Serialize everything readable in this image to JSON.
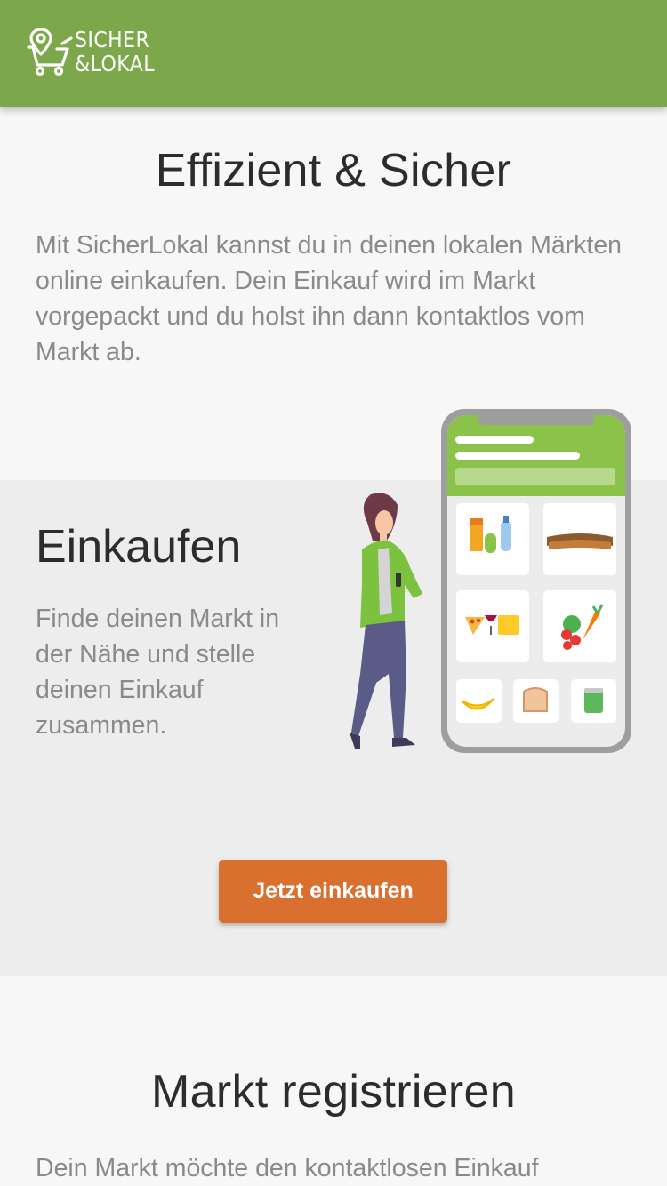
{
  "header": {
    "logo_line1": "SICHER",
    "logo_line2": "&LOKAL",
    "brand_color": "#7ca74a"
  },
  "intro": {
    "title": "Effizient & Sicher",
    "text": "Mit SicherLokal kannst du in deinen lokalen Märkten online einkaufen. Dein Einkauf wird im Markt vorgepackt und du holst ihn dann kontaktlos vom Markt ab."
  },
  "shop": {
    "title": "Einkaufen",
    "text": "Finde deinen Markt in der Nähe und stelle deinen Einkauf zusammen.",
    "button_label": "Jetzt einkaufen",
    "button_color": "#d9702f"
  },
  "register": {
    "title": "Markt registrieren",
    "text": "Dein Markt möchte den kontaktlosen Einkauf"
  },
  "illustration": {
    "icons": [
      "drinks-icon",
      "bread-icon",
      "pizza-wine-cheese-icon",
      "vegetables-icon",
      "banana-icon",
      "toast-icon",
      "can-icon"
    ]
  }
}
